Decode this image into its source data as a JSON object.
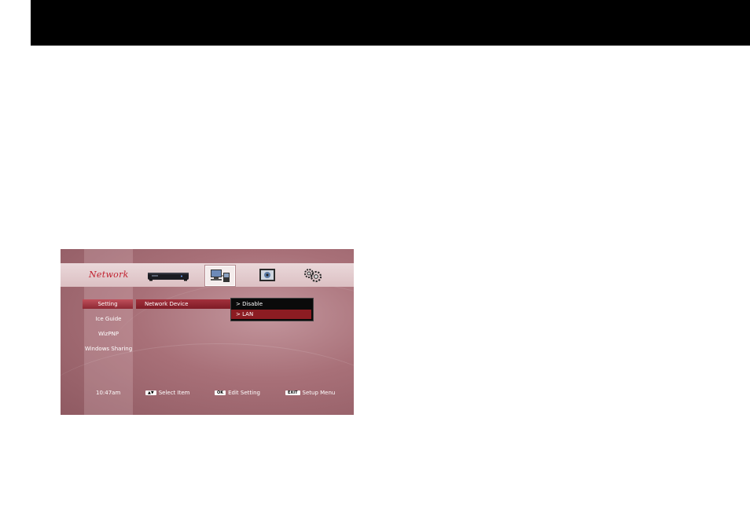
{
  "menu": {
    "title": "Network",
    "icons": [
      "device-icon",
      "network-icon",
      "media-icon",
      "tools-icon"
    ]
  },
  "sidebar": {
    "items": [
      {
        "label": "Setting",
        "active": true
      },
      {
        "label": "Ice Guide"
      },
      {
        "label": "WizPNP"
      },
      {
        "label": "Windows Sharing"
      }
    ]
  },
  "setting": {
    "label": "Network Device",
    "options": [
      "> Disable",
      "> LAN"
    ],
    "selected": "> LAN"
  },
  "footer": {
    "time": "10:47am",
    "hints": [
      {
        "key": "▲▼",
        "label": "Select Item"
      },
      {
        "key": "OK",
        "label": "Edit Setting"
      },
      {
        "key": "EXIT",
        "label": "Setup Menu"
      }
    ]
  }
}
